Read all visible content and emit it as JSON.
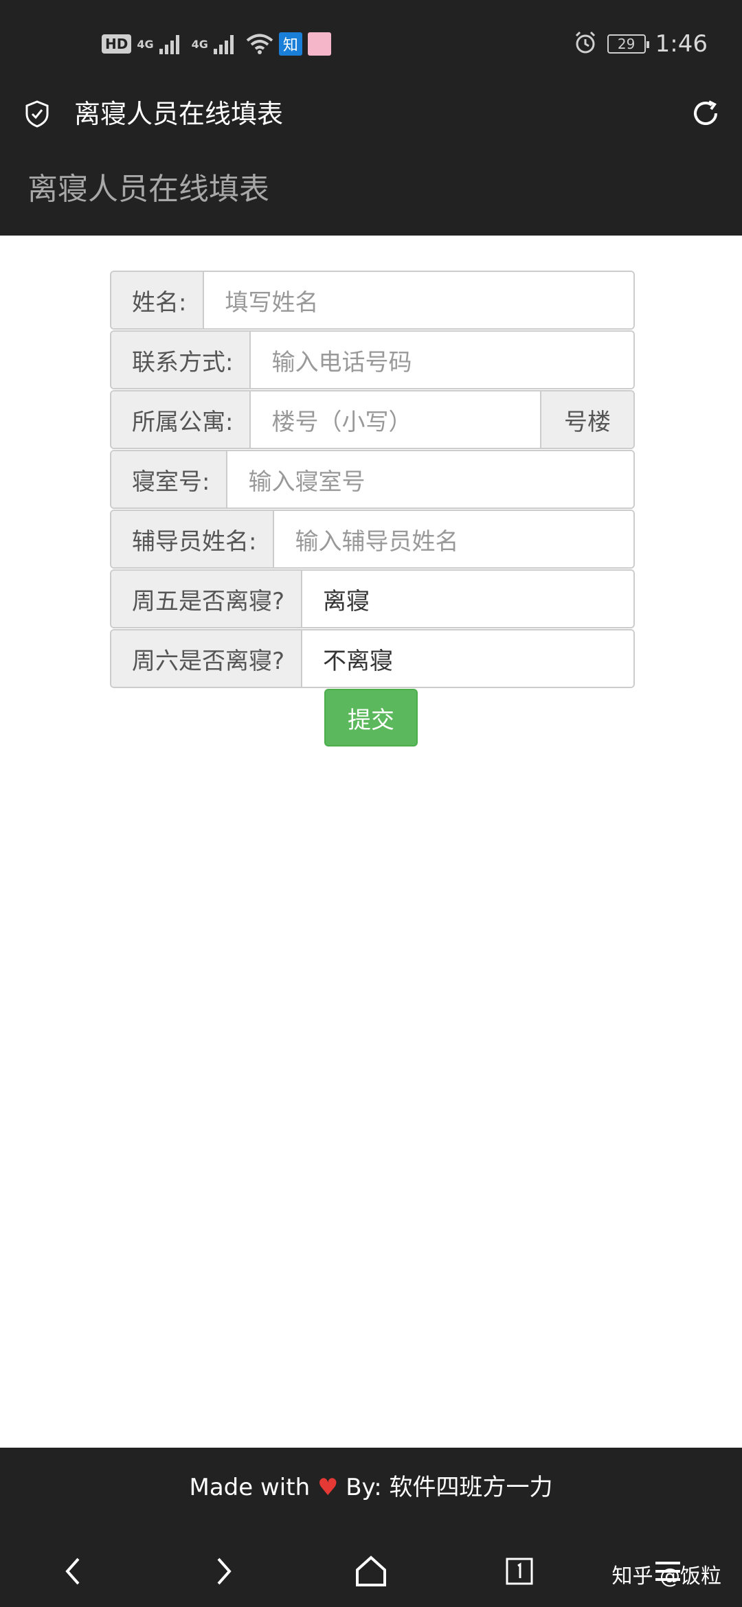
{
  "status_bar": {
    "network_badge": "HD",
    "sim1": "4G",
    "sim2": "4G",
    "app_icon_zhihu": "知",
    "battery": "29",
    "time": "1:46"
  },
  "app_bar": {
    "title": "离寝人员在线填表",
    "shield_icon": "shield-check-icon",
    "refresh_icon": "refresh-icon"
  },
  "page": {
    "title": "离寝人员在线填表"
  },
  "form": {
    "name": {
      "label": "姓名:",
      "placeholder": "填写姓名"
    },
    "contact": {
      "label": "联系方式:",
      "placeholder": "输入电话号码"
    },
    "apartment": {
      "label": "所属公寓:",
      "placeholder": "楼号（小写）",
      "suffix": "号楼"
    },
    "room": {
      "label": "寝室号:",
      "placeholder": "输入寝室号"
    },
    "counselor": {
      "label": "辅导员姓名:",
      "placeholder": "输入辅导员姓名"
    },
    "friday": {
      "label": "周五是否离寝?",
      "value": "离寝"
    },
    "saturday": {
      "label": "周六是否离寝?",
      "value": "不离寝"
    },
    "submit": "提交"
  },
  "footer": {
    "made_with": "Made with",
    "by": "By: 软件四班方一力"
  },
  "watermark": "知乎 @饭粒",
  "colors": {
    "header_bg": "#222222",
    "submit_green": "#5cb85c",
    "heart_red": "#e53935"
  }
}
